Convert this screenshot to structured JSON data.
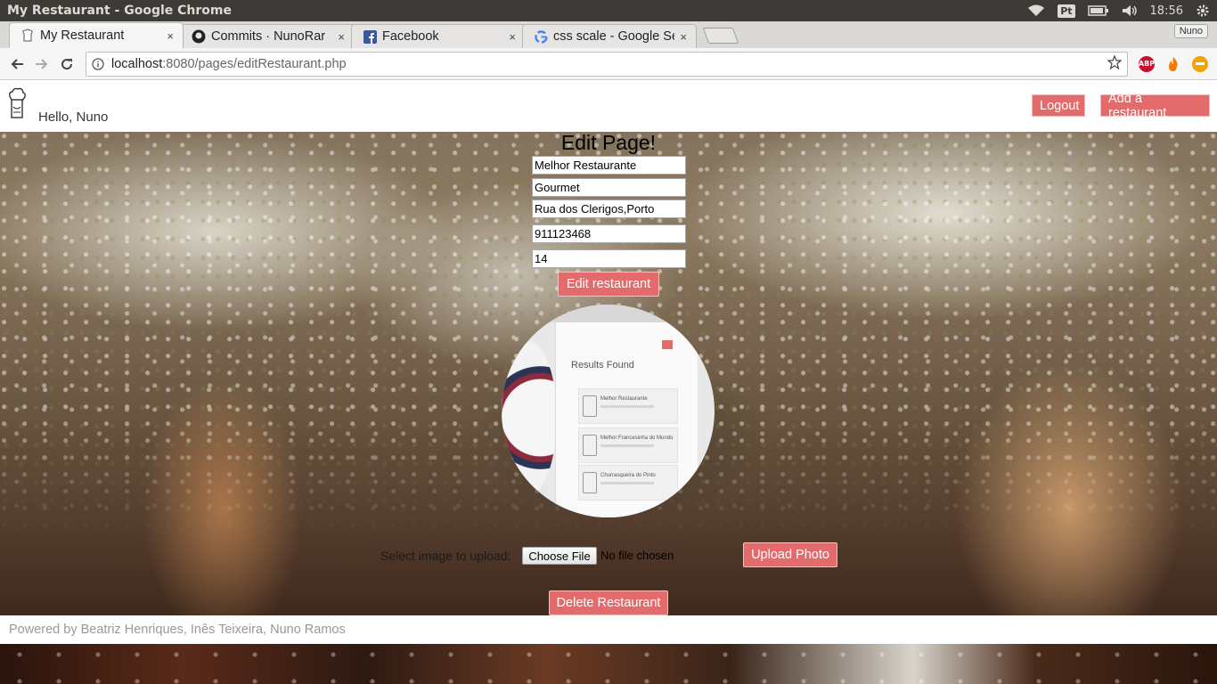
{
  "os": {
    "window_title": "My Restaurant - Google Chrome",
    "input_method": "Pt",
    "clock": "18:56"
  },
  "browser": {
    "tabs": [
      {
        "label": "My Restaurant",
        "icon": "chef-favicon",
        "close": "×"
      },
      {
        "label": "Commits · NunoRar",
        "icon": "github-icon",
        "close": "×"
      },
      {
        "label": "Facebook",
        "icon": "facebook-icon",
        "close": "×"
      },
      {
        "label": "css scale - Google Se",
        "icon": "google-icon",
        "close": "×"
      }
    ],
    "profile_name": "Nuno",
    "url_host": "localhost",
    "url_rest": ":8080/pages/editRestaurant.php",
    "extensions": {
      "abp": "ABP"
    }
  },
  "header": {
    "greeting": "Hello, Nuno",
    "logout_label": "Logout",
    "add_restaurant_label": "Add a restaurant"
  },
  "form": {
    "title": "Edit Page!",
    "fields": {
      "name": "Melhor Restaurante",
      "category": "Gourmet",
      "address": "Rua dos Clerigos,Porto",
      "phone": "911123468",
      "price": "14"
    },
    "edit_button": "Edit restaurant"
  },
  "photo_preview": {
    "heading": "Results Found",
    "items": [
      "Melhor Restaurante",
      "Melhor Francesinha do Mundo",
      "Churrasqueira do Pinto"
    ]
  },
  "upload": {
    "label": "Select image to upload:",
    "choose_file": "Choose File",
    "file_status": "No file chosen",
    "upload_button": "Upload Photo"
  },
  "delete_button": "Delete Restaurant",
  "footer": {
    "credits": "Powered by Beatriz Henriques, Inês Teixeira, Nuno Ramos"
  },
  "colors": {
    "accent": "#e36b6b",
    "os_bar": "#3c3b37"
  }
}
